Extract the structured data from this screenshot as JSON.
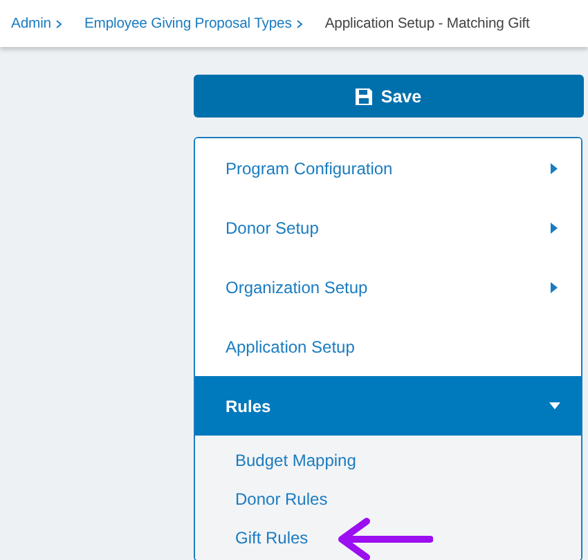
{
  "breadcrumb": [
    {
      "label": "Admin",
      "current": false
    },
    {
      "label": "Employee Giving Proposal Types",
      "current": false
    },
    {
      "label": "Application Setup - Matching Gift",
      "current": true
    }
  ],
  "save_button": {
    "label": "Save"
  },
  "menu": {
    "items": [
      {
        "label": "Program Configuration",
        "has_submenu": true,
        "expanded": false,
        "selected": false
      },
      {
        "label": "Donor Setup",
        "has_submenu": true,
        "expanded": false,
        "selected": false
      },
      {
        "label": "Organization Setup",
        "has_submenu": true,
        "expanded": false,
        "selected": false
      },
      {
        "label": "Application Setup",
        "has_submenu": false,
        "expanded": false,
        "selected": false
      },
      {
        "label": "Rules",
        "has_submenu": true,
        "expanded": true,
        "selected": true,
        "children": [
          {
            "label": "Budget Mapping"
          },
          {
            "label": "Donor Rules"
          },
          {
            "label": "Gift Rules"
          }
        ]
      }
    ]
  }
}
